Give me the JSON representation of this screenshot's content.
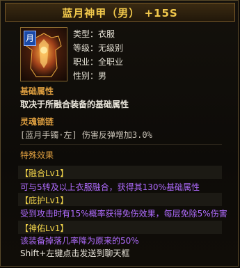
{
  "item": {
    "title": "蓝月神甲（男）  +15S",
    "badge": "月",
    "stats": [
      {
        "label": "类型：",
        "value": "衣服"
      },
      {
        "label": "等级：",
        "value": "无级别"
      },
      {
        "label": "职业：",
        "value": "全职业"
      },
      {
        "label": "性别：",
        "value": "男"
      }
    ]
  },
  "base": {
    "title": "基础属性",
    "desc": "取决于所融合装备的基础属性"
  },
  "soul": {
    "title": "灵魂锁链",
    "line": "[蓝月手镯·左] 伤害反弹增加3.0%"
  },
  "special": {
    "title": "特殊效果",
    "skills": [
      {
        "name": "【融合Lv1】",
        "desc": "可与5转及以上衣服融合，获得其130%基础属性"
      },
      {
        "name": "【庇护Lv1】",
        "desc": "受到攻击时有15%概率获得免伤效果，每层免除5%伤害"
      },
      {
        "name": "【神佑Lv1】",
        "desc": "该装备掉落几率降为原来的50%"
      }
    ]
  },
  "footer": "Shift+左键点击发送到聊天框",
  "colors": {
    "title": "#f2c94c",
    "section": "#e0a040",
    "skill_name": "#f2d44a",
    "skill_desc": "#b06cff"
  }
}
